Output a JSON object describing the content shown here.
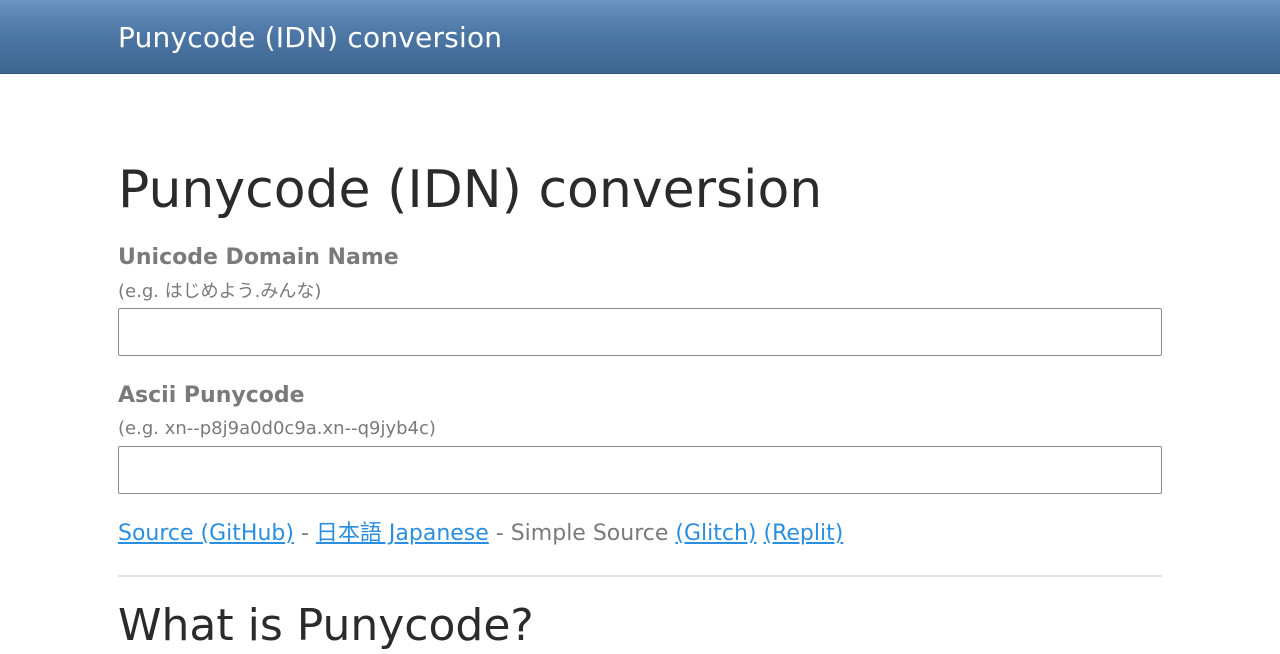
{
  "navbar": {
    "brand": "Punycode (IDN) conversion"
  },
  "main": {
    "title": "Punycode (IDN) conversion",
    "unicode_field": {
      "label": "Unicode Domain Name",
      "hint": "(e.g. はじめよう.みんな)",
      "value": "",
      "placeholder": ""
    },
    "ascii_field": {
      "label": "Ascii Punycode",
      "hint": "(e.g. xn--p8j9a0d0c9a.xn--q9jyb4c)",
      "value": "",
      "placeholder": ""
    },
    "links": {
      "source_github": "Source (GitHub)",
      "sep1": " - ",
      "japanese": "日本語 Japanese",
      "sep2": " - Simple Source ",
      "glitch": "(Glitch)",
      "sep3": " ",
      "replit": "(Replit)"
    },
    "section_title": "What is Punycode?"
  },
  "colors": {
    "navbar_top": "#6a93c2",
    "navbar_bottom": "#3f6690",
    "link": "#2a8fe0",
    "label": "#7a7a7a",
    "title": "#2b2b2b"
  }
}
